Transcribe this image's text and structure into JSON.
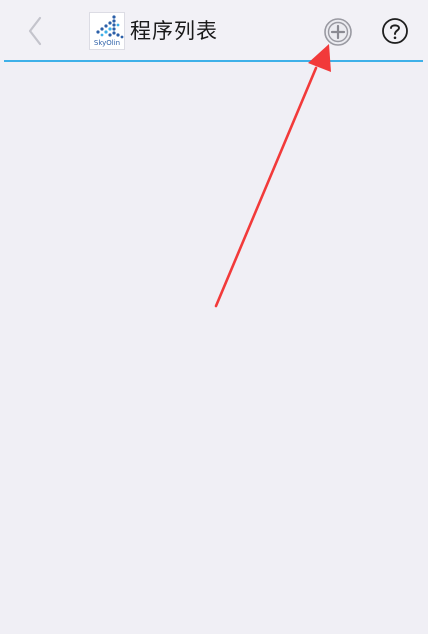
{
  "header": {
    "title": "程序列表",
    "logo": {
      "text": "SkyOlin",
      "icon": "skyolin-logo-icon"
    },
    "back_icon": "chevron-left-icon",
    "add_icon": "plus-circle-icon",
    "help_icon": "question-circle-icon"
  },
  "colors": {
    "accent": "#3eb0e8",
    "background": "#f0eff5",
    "arrow": "#f23a3a"
  }
}
